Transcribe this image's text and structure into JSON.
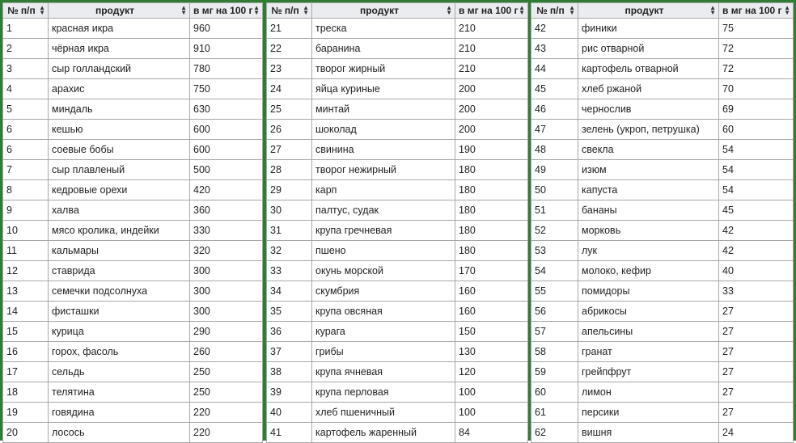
{
  "headers": {
    "num": "№ п/п",
    "product": "продукт",
    "value": "в мг на 100 г"
  },
  "tables": [
    {
      "rows": [
        [
          "1",
          "красная икра",
          "960"
        ],
        [
          "2",
          "чёрная икра",
          "910"
        ],
        [
          "3",
          "сыр голландский",
          "780"
        ],
        [
          "4",
          "арахис",
          "750"
        ],
        [
          "5",
          "миндаль",
          "630"
        ],
        [
          "6",
          "кешью",
          "600"
        ],
        [
          "6",
          "соевые бобы",
          "600"
        ],
        [
          "7",
          "сыр плавленый",
          "500"
        ],
        [
          "8",
          "кедровые орехи",
          "420"
        ],
        [
          "9",
          "халва",
          "360"
        ],
        [
          "10",
          "мясо кролика, индейки",
          "330"
        ],
        [
          "11",
          "кальмары",
          "320"
        ],
        [
          "12",
          "ставрида",
          "300"
        ],
        [
          "13",
          "семечки подсолнуха",
          "300"
        ],
        [
          "14",
          "фисташки",
          "300"
        ],
        [
          "15",
          "курица",
          "290"
        ],
        [
          "16",
          "горох, фасоль",
          "260"
        ],
        [
          "17",
          "сельдь",
          "250"
        ],
        [
          "18",
          "телятина",
          "250"
        ],
        [
          "19",
          "говядина",
          "220"
        ],
        [
          "20",
          "лосось",
          "220"
        ]
      ]
    },
    {
      "rows": [
        [
          "21",
          "треска",
          "210"
        ],
        [
          "22",
          "баранина",
          "210"
        ],
        [
          "23",
          "творог жирный",
          "210"
        ],
        [
          "24",
          "яйца куриные",
          "200"
        ],
        [
          "25",
          "минтай",
          "200"
        ],
        [
          "26",
          "шоколад",
          "200"
        ],
        [
          "27",
          "свинина",
          "190"
        ],
        [
          "28",
          "творог нежирный",
          "180"
        ],
        [
          "29",
          "карп",
          "180"
        ],
        [
          "30",
          "палтус, судак",
          "180"
        ],
        [
          "31",
          "крупа гречневая",
          "180"
        ],
        [
          "32",
          "пшено",
          "180"
        ],
        [
          "33",
          "окунь морской",
          "170"
        ],
        [
          "34",
          "скумбрия",
          "160"
        ],
        [
          "35",
          "крупа овсяная",
          "160"
        ],
        [
          "36",
          "курага",
          "150"
        ],
        [
          "37",
          "грибы",
          "130"
        ],
        [
          "38",
          "крупа ячневая",
          "120"
        ],
        [
          "39",
          "крупа перловая",
          "100"
        ],
        [
          "40",
          "хлеб пшеничный",
          "100"
        ],
        [
          "41",
          "картофель жаренный",
          "84"
        ]
      ]
    },
    {
      "rows": [
        [
          "42",
          "финики",
          "75"
        ],
        [
          "43",
          "рис отварной",
          "72"
        ],
        [
          "44",
          "картофель отварной",
          "72"
        ],
        [
          "45",
          "хлеб ржаной",
          "70"
        ],
        [
          "46",
          "чернослив",
          "69"
        ],
        [
          "47",
          "зелень (укроп, петрушка)",
          "60"
        ],
        [
          "48",
          "свекла",
          "54"
        ],
        [
          "49",
          "изюм",
          "54"
        ],
        [
          "50",
          "капуста",
          "54"
        ],
        [
          "51",
          "бананы",
          "45"
        ],
        [
          "52",
          "морковь",
          "42"
        ],
        [
          "53",
          "лук",
          "42"
        ],
        [
          "54",
          "молоко, кефир",
          "40"
        ],
        [
          "55",
          "помидоры",
          "33"
        ],
        [
          "56",
          "абрикосы",
          "27"
        ],
        [
          "57",
          "апельсины",
          "27"
        ],
        [
          "58",
          "гранат",
          "27"
        ],
        [
          "59",
          "грейпфрут",
          "27"
        ],
        [
          "60",
          "лимон",
          "27"
        ],
        [
          "61",
          "персики",
          "27"
        ],
        [
          "62",
          "вишня",
          "24"
        ]
      ]
    }
  ]
}
